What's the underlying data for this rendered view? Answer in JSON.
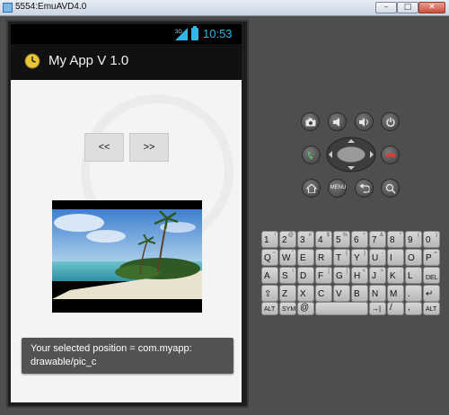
{
  "window": {
    "title": "5554:EmuAVD4.0",
    "min_label": "–",
    "max_label": "□",
    "close_label": "✕"
  },
  "statusbar": {
    "network": "3G",
    "time": "10:53"
  },
  "app": {
    "title": "My App V 1.0"
  },
  "buttons": {
    "prev_label": "<<",
    "next_label": ">>"
  },
  "toast": {
    "message": "Your selected position = com.myapp: drawable/pic_c"
  },
  "controls": {
    "menu_label": "MENU"
  },
  "keyboard": {
    "rows": [
      [
        {
          "main": "1",
          "sub": "!"
        },
        {
          "main": "2",
          "sub": "@"
        },
        {
          "main": "3",
          "sub": "#"
        },
        {
          "main": "4",
          "sub": "$"
        },
        {
          "main": "5",
          "sub": "%"
        },
        {
          "main": "6",
          "sub": "^"
        },
        {
          "main": "7",
          "sub": "&"
        },
        {
          "main": "8",
          "sub": "*"
        },
        {
          "main": "9",
          "sub": "("
        },
        {
          "main": "0",
          "sub": ")"
        }
      ],
      [
        {
          "main": "Q",
          "sub": "~"
        },
        {
          "main": "W",
          "sub": "\""
        },
        {
          "main": "E",
          "sub": "´"
        },
        {
          "main": "R",
          "sub": ""
        },
        {
          "main": "T",
          "sub": "{"
        },
        {
          "main": "Y",
          "sub": "}"
        },
        {
          "main": "U",
          "sub": "-"
        },
        {
          "main": "I",
          "sub": ""
        },
        {
          "main": "O",
          "sub": ""
        },
        {
          "main": "P",
          "sub": "="
        }
      ],
      [
        {
          "main": "A",
          "sub": ""
        },
        {
          "main": "S",
          "sub": "\\"
        },
        {
          "main": "D",
          "sub": ""
        },
        {
          "main": "F",
          "sub": "["
        },
        {
          "main": "G",
          "sub": "]"
        },
        {
          "main": "H",
          "sub": "<"
        },
        {
          "main": "J",
          "sub": ">"
        },
        {
          "main": "K",
          "sub": ";"
        },
        {
          "main": "L",
          "sub": ":"
        },
        {
          "main": "DEL",
          "sub": ""
        }
      ],
      [
        {
          "main": "⇧",
          "sub": ""
        },
        {
          "main": "Z",
          "sub": ""
        },
        {
          "main": "X",
          "sub": ""
        },
        {
          "main": "C",
          "sub": ""
        },
        {
          "main": "V",
          "sub": ""
        },
        {
          "main": "B",
          "sub": ""
        },
        {
          "main": "N",
          "sub": ""
        },
        {
          "main": "M",
          "sub": ""
        },
        {
          "main": ".",
          "sub": ""
        },
        {
          "main": "↵",
          "sub": ""
        }
      ]
    ],
    "bottom": {
      "alt_left": "ALT",
      "sym": "SYM",
      "at": "@",
      "space": "",
      "arrow": "→|",
      "slash": "/",
      "comma": ",",
      "alt_right": "ALT"
    }
  },
  "colors": {
    "accent": "#33b5e5",
    "screen_bg": "#f4f4f4",
    "toast_bg": "#464646"
  }
}
